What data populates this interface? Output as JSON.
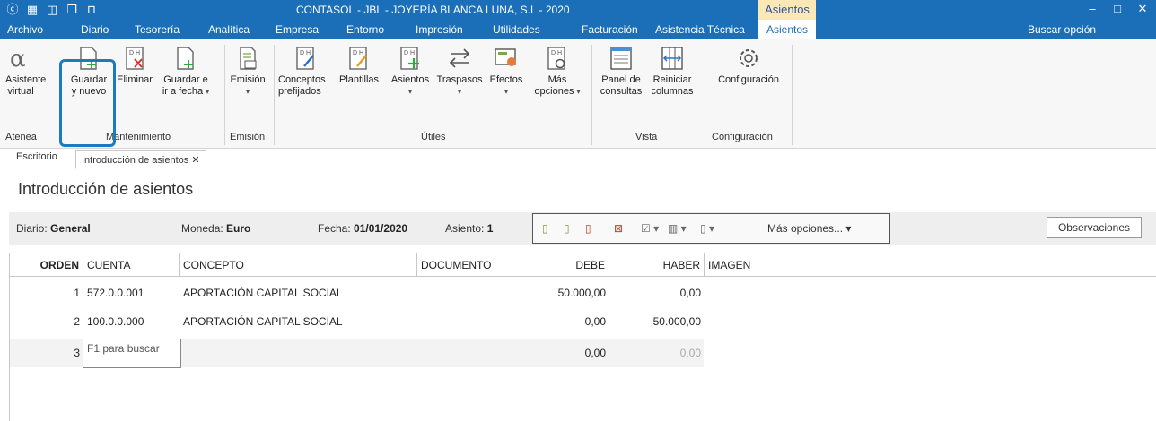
{
  "titlebar": {
    "title": "CONTASOL - JBL - JOYERÍA BLANCA LUNA, S.L - 2020",
    "context_tab": "Asientos",
    "qa_icons": [
      "cs-logo-icon",
      "calculator-icon",
      "window-icon",
      "copy-icon",
      "lock-icon"
    ]
  },
  "menu": {
    "items": [
      "Archivo",
      "Diario",
      "Tesorería",
      "Analítica",
      "Empresa",
      "Entorno",
      "Impresión",
      "Utilidades",
      "Facturación",
      "Asistencia Técnica"
    ],
    "active": "Asientos",
    "search": "Buscar opción"
  },
  "ribbon": {
    "asistente": [
      "Asistente",
      "virtual"
    ],
    "guardar": [
      "Guardar",
      "y nuevo"
    ],
    "eliminar": [
      "Eliminar"
    ],
    "guardar_fecha": [
      "Guardar e",
      "ir a fecha"
    ],
    "emision": [
      "Emisión"
    ],
    "conceptos": [
      "Conceptos",
      "prefijados"
    ],
    "plantillas": [
      "Plantillas"
    ],
    "asientos": [
      "Asientos"
    ],
    "traspasos": [
      "Traspasos"
    ],
    "efectos": [
      "Efectos"
    ],
    "mas": [
      "Más",
      "opciones"
    ],
    "panel": [
      "Panel de",
      "consultas"
    ],
    "reiniciar": [
      "Reiniciar",
      "columnas"
    ],
    "configuracion": [
      "Configuración"
    ],
    "groups": {
      "atenea": "Atenea",
      "mantenimiento": "Mantenimiento",
      "emision": "Emisión",
      "utiles": "Útiles",
      "vista": "Vista",
      "configuracion": "Configuración"
    }
  },
  "tabs": {
    "escritorio": "Escritorio",
    "introduccion": "Introducción de asientos",
    "close": "✕"
  },
  "page_title": "Introducción de asientos",
  "info": {
    "diario_label": "Diario:",
    "diario_value": "General",
    "moneda_label": "Moneda:",
    "moneda_value": "Euro",
    "fecha_label": "Fecha:",
    "fecha_value": "01/01/2020",
    "asiento_label": "Asiento:",
    "asiento_value": "1",
    "mas_opciones": "Más opciones...",
    "observaciones": "Observaciones"
  },
  "table": {
    "headers": {
      "orden": "ORDEN",
      "cuenta": "CUENTA",
      "concepto": "CONCEPTO",
      "documento": "DOCUMENTO",
      "debe": "DEBE",
      "haber": "HABER",
      "imagen": "IMAGEN"
    },
    "rows": [
      {
        "orden": "1",
        "cuenta": "572.0.0.001",
        "concepto": "APORTACIÓN CAPITAL SOCIAL",
        "debe": "50.000,00",
        "haber": "0,00"
      },
      {
        "orden": "2",
        "cuenta": "100.0.0.000",
        "concepto": "APORTACIÓN CAPITAL SOCIAL",
        "debe": "0,00",
        "haber": "50.000,00"
      },
      {
        "orden": "3",
        "cuenta": "",
        "concepto": "",
        "debe": "0,00",
        "haber": "0,00"
      }
    ],
    "input_placeholder": "F1 para buscar"
  }
}
